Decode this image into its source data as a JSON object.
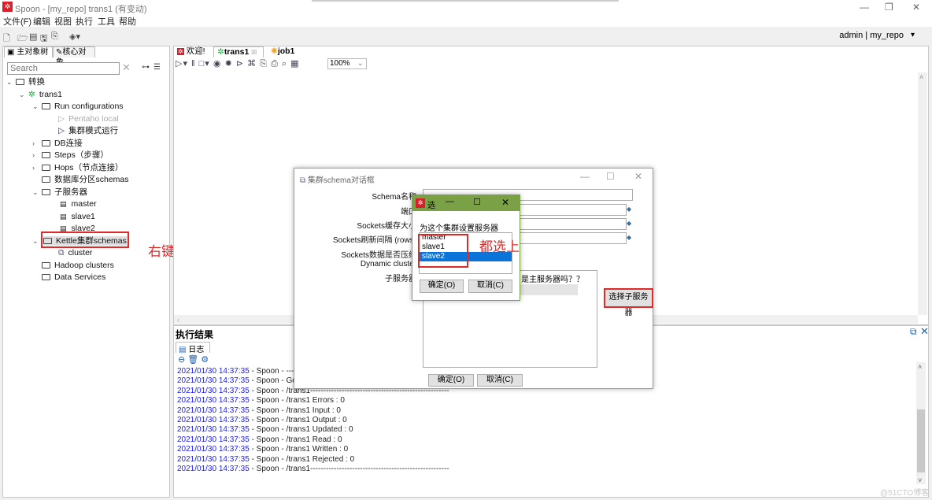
{
  "window": {
    "title": "Spoon - [my_repo] trans1 (有变动)",
    "app_icon_glyph": "✲",
    "controls": {
      "minimize": "—",
      "maximize": "❐",
      "close": "✕"
    }
  },
  "menu": [
    "文件(F)",
    "编辑",
    "视图",
    "执行",
    "工具",
    "帮助"
  ],
  "toolbar": {
    "icons": [
      "new-file-icon",
      "open-file-icon",
      "explore-repo-icon",
      "save-icon",
      "save-as-icon",
      "layers-icon"
    ],
    "user": "admin",
    "separator": "|",
    "repo": "my_repo",
    "dropdown": "▾"
  },
  "left_panel": {
    "tabs": [
      "主对象树",
      "核心对象"
    ],
    "search": {
      "placeholder": "Search",
      "value": "Search"
    },
    "tree": [
      {
        "label": "转换",
        "level": 0,
        "expanded": true,
        "type": "folder"
      },
      {
        "label": "trans1",
        "level": 1,
        "expanded": true,
        "type": "trans"
      },
      {
        "label": "Run configurations",
        "level": 2,
        "expanded": true,
        "type": "folder"
      },
      {
        "label": "Pentaho local",
        "level": 3,
        "type": "run",
        "disabled": true
      },
      {
        "label": "集群模式运行",
        "level": 3,
        "type": "run"
      },
      {
        "label": "DB连接",
        "level": 2,
        "expanded": false,
        "type": "folder"
      },
      {
        "label": "Steps（步骤）",
        "level": 2,
        "expanded": false,
        "type": "folder"
      },
      {
        "label": "Hops（节点连接）",
        "level": 2,
        "expanded": false,
        "type": "folder"
      },
      {
        "label": "数据库分区schemas",
        "level": 2,
        "type": "folder"
      },
      {
        "label": "子服务器",
        "level": 2,
        "expanded": true,
        "type": "folder"
      },
      {
        "label": "master",
        "level": 3,
        "type": "server"
      },
      {
        "label": "slave1",
        "level": 3,
        "type": "server"
      },
      {
        "label": "slave2",
        "level": 3,
        "type": "server"
      },
      {
        "label": "Kettle集群schemas",
        "level": 2,
        "expanded": true,
        "type": "folder",
        "highlighted": true
      },
      {
        "label": "cluster",
        "level": 3,
        "type": "cluster"
      },
      {
        "label": "Hadoop clusters",
        "level": 2,
        "type": "folder"
      },
      {
        "label": "Data Services",
        "level": 2,
        "type": "folder"
      }
    ]
  },
  "annotations": {
    "right_click_new": "右键新建",
    "select_all": "都选上"
  },
  "editor": {
    "tabs": [
      {
        "label": "欢迎!",
        "active": false
      },
      {
        "label": "trans1",
        "active": true,
        "closable": "☒"
      },
      {
        "label": "job1",
        "active": false
      }
    ],
    "zoom": "100%"
  },
  "exec_results": {
    "title": "执行结果",
    "tab": "日志",
    "log": [
      {
        "ts": "2021/01/30 14:37:35",
        "msg": " - Spoon - ---"
      },
      {
        "ts": "2021/01/30 14:37:35",
        "msg": " - Spoon - Go"
      },
      {
        "ts": "2021/01/30 14:37:35",
        "msg": " - Spoon - /trans1-----------------------------------------------------"
      },
      {
        "ts": "2021/01/30 14:37:35",
        "msg": " - Spoon - /trans1 Errors : 0"
      },
      {
        "ts": "2021/01/30 14:37:35",
        "msg": " - Spoon - /trans1 Input : 0"
      },
      {
        "ts": "2021/01/30 14:37:35",
        "msg": " - Spoon - /trans1 Output : 0"
      },
      {
        "ts": "2021/01/30 14:37:35",
        "msg": " - Spoon - /trans1 Updated : 0"
      },
      {
        "ts": "2021/01/30 14:37:35",
        "msg": " - Spoon - /trans1 Read : 0"
      },
      {
        "ts": "2021/01/30 14:37:35",
        "msg": " - Spoon - /trans1 Written : 0"
      },
      {
        "ts": "2021/01/30 14:37:35",
        "msg": " - Spoon - /trans1 Rejected : 0"
      },
      {
        "ts": "2021/01/30 14:37:35",
        "msg": " - Spoon - /trans1-----------------------------------------------------"
      }
    ]
  },
  "cluster_dialog": {
    "title": "集群schema对话框",
    "labels": [
      "Schema名称",
      "端口",
      "Sockets缓存大小",
      "Sockets刷新间隔 (rows)",
      "Sockets数据是否压缩",
      "Dynamic cluster",
      "子服务器"
    ],
    "table_header": "是主服务器吗？？",
    "select_servers_button": "选择子服务器",
    "ok": "确定(O)",
    "cancel": "取消(C)"
  },
  "server_picker": {
    "title": "选",
    "prompt": "为这个集群设置服务器",
    "options": [
      "master",
      "slave1",
      "slave2"
    ],
    "selected": "slave2",
    "ok": "确定(O)",
    "cancel": "取消(C)"
  },
  "watermark": "@51CTO博客"
}
